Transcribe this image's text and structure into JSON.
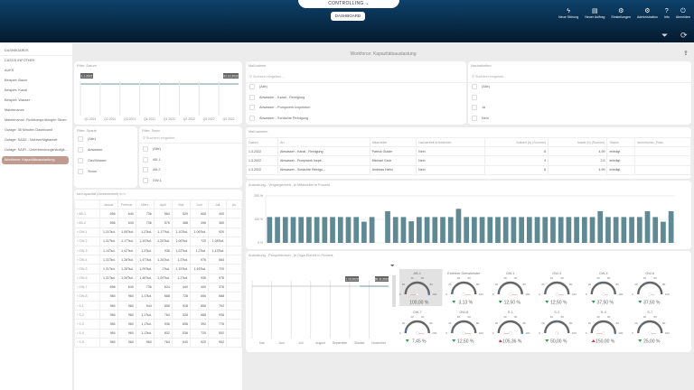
{
  "header": {
    "module": "CONTROLLING",
    "dashboard_button": "DASHBOARD",
    "tools": [
      {
        "label": "Neue Störung",
        "icon": "bolt-icon"
      },
      {
        "label": "Neuer Auftrag",
        "icon": "clipboard-icon"
      },
      {
        "label": "Einstellungen",
        "icon": "gear-icon"
      },
      {
        "label": "Administration",
        "icon": "gears-icon"
      },
      {
        "label": "Info",
        "icon": "question-icon"
      },
      {
        "label": "Abmelden",
        "icon": "power-icon"
      }
    ]
  },
  "sidebar": {
    "heading": "DASHBOARDS",
    "items": [
      "CASOS INFOTHEK",
      "AUKS",
      "Beispiel: Baum",
      "Beispiel: Kanal",
      "Beispiel: Wasser",
      "Maintenance",
      "Maintenance: Funktionsprüfungen Strom",
      "Outage: 38 Minuten Dashboard",
      "Outage: SAIDI - Nichtverfügbarkeit",
      "Outage: SAIFI - Unterbrechungshäufigk...",
      "Workforce: Kapazitätsauslastung"
    ],
    "active_index": 10
  },
  "page": {
    "title": "Workforce: Kapazitätsauslastung"
  },
  "filter_datum": {
    "title": "Filter: Datum",
    "start": "1.1.2021",
    "end": "31.12.2022",
    "ticks": [
      "Q1 2021",
      "Q2 2021",
      "Q3 2021",
      "Q4 2021",
      "Q1 2022",
      "Q2 2022",
      "Q3 2022",
      "Q4 2022"
    ]
  },
  "filter_sparte": {
    "title": "Filter: Sparte",
    "options": [
      "(Alle)",
      "Abwasser",
      "Gas/Wasser",
      "Strom"
    ]
  },
  "filter_team": {
    "title": "Filter: Team",
    "placeholder": "Suchtext eingeben...",
    "options": [
      "(Alle)",
      "AB-1",
      "AB-2",
      "GW-1"
    ]
  },
  "massnahme": {
    "title": "Maßnahme",
    "placeholder": "Suchtext eingeben...",
    "options": [
      "(Alle)",
      "Abwasser - Kanal - Reinigung",
      "Abwasser - Pumpwerk Inspektion",
      "Abwasser - Schächte Reinigung"
    ]
  },
  "nacharbeiten": {
    "title": "Nacharbeiten",
    "placeholder": "Suchtext eingeben...",
    "options": [
      "(Alle)",
      "",
      "Ja",
      "Nein"
    ]
  },
  "massnahmen_table": {
    "title": "Maßnahmen",
    "columns": [
      "Datum",
      "Art",
      "Mitarbeiter",
      "Nacharbeit erforderlich",
      "Sollzeit (h) (Summe)",
      "Istzeit (h) (Summe)",
      "Status",
      "technischer_Platz"
    ],
    "rows": [
      [
        "1.3.2022",
        "Abwasser - Kanal - Reinigung",
        "Patrick Gulder",
        "Nein",
        "8",
        "4,99",
        "erledigt",
        ""
      ],
      [
        "1.3.2022",
        "Abwasser - Pumpwerk Inspe...",
        "Michael Grub",
        "Nein",
        "4",
        "2,5",
        "erledigt",
        ""
      ],
      [
        "1.3.2022",
        "Abwasser - Schächte Reinigu...",
        "Andreas Hahn",
        "Nein",
        "8",
        "4,99",
        "erledigt",
        ""
      ]
    ]
  },
  "ist_kapazitaet": {
    "title": "Ist-Kapazität (Anwesenheit) in h",
    "columns": [
      "",
      "Januar",
      "Februar",
      "März",
      "April",
      "Mai",
      "Juni",
      "Juli",
      "Au"
    ],
    "rows": [
      [
        "AB-1",
        "656",
        "640",
        "736",
        "584",
        "520",
        "608",
        "400"
      ],
      [
        "AB-2",
        "656",
        "640",
        "736",
        "576",
        "488",
        "496",
        "360"
      ],
      [
        "GW-1",
        "1,31Tsd.",
        "1,08Tsd.",
        "1,2Tsd.",
        "1,17Tsd.",
        "1,10Tsd.",
        "1,06Tsd.",
        "920"
      ],
      [
        "GW-2",
        "1,31Tsd.",
        "1,17Tsd.",
        "1,34Tsd.",
        "1,25Tsd.",
        "1,06Tsd.",
        "720",
        "1,08Tsd."
      ],
      [
        "GW-3",
        "1,14Tsd.",
        "1,02Tsd.",
        "1,3Tsd.",
        "936",
        "1,22Tsd.",
        "1,2Tsd.",
        "1,13Tsd."
      ],
      [
        "GW-4",
        "1,31Tsd.",
        "1,28Tsd.",
        "1,47Tsd.",
        "1,25Tsd.",
        "1,2Tsd.",
        "976",
        "584"
      ],
      [
        "GW-5",
        "1,31Tsd.",
        "1,28Tsd.",
        "1,29Tsd.",
        "1Tsd.",
        "1,15Tsd.",
        "1,16Tsd.",
        "720"
      ],
      [
        "GW-6",
        "1,31Tsd.",
        "1,28Tsd.",
        "1,46Tsd.",
        "1,09Tsd.",
        "1,1Tsd.",
        "936",
        "976"
      ],
      [
        "GW-7",
        "656",
        "640",
        "736",
        "624",
        "440",
        "400",
        "376"
      ],
      [
        "GW-8",
        "984",
        "960",
        "1,1Tsd.",
        "688",
        "728",
        "656",
        "688"
      ],
      [
        "S-1",
        "984",
        "960",
        "944",
        "856",
        "928",
        "856",
        "792"
      ],
      [
        "S-2",
        "984",
        "960",
        "1,1Tsd.",
        "784",
        "528",
        "688",
        "936"
      ],
      [
        "S-3",
        "984",
        "960",
        "1,1Tsd.",
        "936",
        "656",
        "392",
        "776"
      ],
      [
        "S-4",
        "984",
        "960",
        "1,1Tsd.",
        "832",
        "536",
        "720",
        "552"
      ],
      [
        "S-5",
        "984",
        "960",
        "960",
        "784",
        "640",
        "520",
        "952"
      ]
    ]
  },
  "chart_data": [
    {
      "type": "bar",
      "title": "Auslastung - Vergangenheit - je Mitarbeiter in Prozent",
      "yticks": [
        "0 %",
        "100 %",
        "200 %"
      ],
      "ylim": [
        0,
        200
      ],
      "color": "#5f8a93",
      "values": [
        110,
        110,
        110,
        110,
        110,
        110,
        110,
        110,
        110,
        110,
        110,
        110,
        90,
        110,
        null,
        135,
        110,
        110,
        92,
        110,
        110,
        110,
        110,
        110,
        145,
        110,
        110,
        110,
        110,
        110,
        110,
        110,
        110,
        110,
        110,
        110,
        110,
        110,
        110,
        110,
        110,
        110,
        135,
        110,
        110,
        110,
        110,
        110,
        135,
        110,
        90,
        135
      ]
    },
    {
      "type": "line",
      "title": "Auslastung - Perspektivisch - je Orga-Einheit in Prozent",
      "x": [
        "Mai",
        "Juni",
        "Juli",
        "August",
        "September",
        "Oktober",
        "November"
      ],
      "range_labels": [
        "1.10.2022",
        "30.11.2022"
      ]
    },
    {
      "type": "gauge",
      "range": [
        0,
        100
      ],
      "ticks": [
        "0",
        "20",
        "40",
        "60",
        "80",
        "100"
      ],
      "gauges": [
        {
          "name": "AB-1",
          "value": 100,
          "label": "100,00 %",
          "trend": "none",
          "selected": true
        },
        {
          "name": "Externer Dienstleister",
          "value": 3.13,
          "label": "3,13 %",
          "trend": "down"
        },
        {
          "name": "GW-1",
          "value": 12.5,
          "label": "12,50 %",
          "trend": "down"
        },
        {
          "name": "GW-3",
          "value": 12.5,
          "label": "12,50 %",
          "trend": "down"
        },
        {
          "name": "GW-4",
          "value": 37.5,
          "label": "37,50 %",
          "trend": "down"
        },
        {
          "name": "GW-6",
          "value": 37.5,
          "label": "37,50 %",
          "trend": "down"
        },
        {
          "name": "GW-7",
          "value": 7.45,
          "label": "7,45 %",
          "trend": "down"
        },
        {
          "name": "GW-8",
          "value": 12.5,
          "label": "12,50 %",
          "trend": "down"
        },
        {
          "name": "S-1",
          "value": 105.36,
          "label": "105,36 %",
          "trend": "up"
        },
        {
          "name": "S-2",
          "value": 50,
          "label": "50,00 %",
          "trend": "down"
        },
        {
          "name": "S-4",
          "value": 150,
          "label": "150,00 %",
          "trend": "up"
        },
        {
          "name": "S-7",
          "value": 25,
          "label": "25,00 %",
          "trend": "down"
        }
      ],
      "colors": {
        "down": "#2e9e4a",
        "up": "#d8334a"
      }
    }
  ]
}
